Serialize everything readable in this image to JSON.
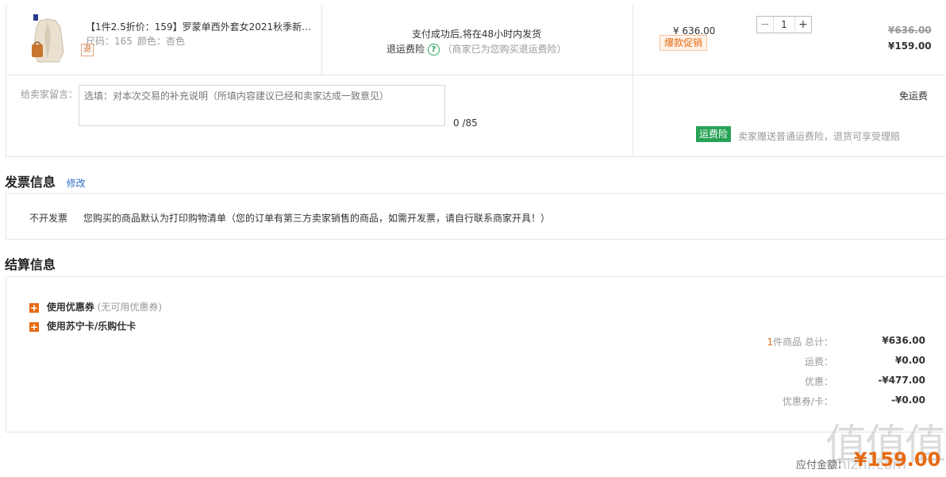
{
  "product": {
    "title": "【1件2.5折价：159】罗蒙单西外套女2021秋季新…",
    "size_label": "尺码：165",
    "color_label": "颜色：杏色",
    "return_badge": "退",
    "shipping_note": "支付成功后,将在48小时内发货",
    "insurance_label": "退运费险",
    "insurance_note": "（商家已为您购买退运费险）",
    "unit_price": "¥ 636.00",
    "promo_tag": "爆款促销",
    "quantity": "1",
    "original_total": "¥636.00",
    "final_total": "¥159.00"
  },
  "note": {
    "label": "给卖家留言：",
    "placeholder": "选填：对本次交易的补充说明（所填内容建议已经和卖家达成一致意见）",
    "counter": "0 /85",
    "free_shipping": "免运费",
    "insurance_tag": "运费险",
    "insurance_desc": "卖家赠送普通运费险，退货可享受理赔"
  },
  "invoice": {
    "title": "发票信息",
    "edit_link": "修改",
    "type": "不开发票",
    "desc": "您购买的商品默认为打印购物清单（您的订单有第三方卖家销售的商品，如需开发票，请自行联系商家开具！）"
  },
  "settlement": {
    "title": "结算信息",
    "coupon_label": "使用优惠券",
    "coupon_note": "(无可用优惠券)",
    "card_label": "使用苏宁卡/乐购仕卡",
    "item_count_prefix": "1",
    "rows": [
      {
        "label": "件商品 总计：",
        "value": "¥636.00"
      },
      {
        "label": "运费：",
        "value": "¥0.00"
      },
      {
        "label": "优惠：",
        "value": "-¥477.00"
      },
      {
        "label": "优惠券/卡：",
        "value": "-¥0.00"
      }
    ],
    "payable_label": "应付金额：",
    "payable_value": "¥159.00"
  },
  "watermark": {
    "main": "值值值",
    "sub": "zhizhi.com"
  }
}
